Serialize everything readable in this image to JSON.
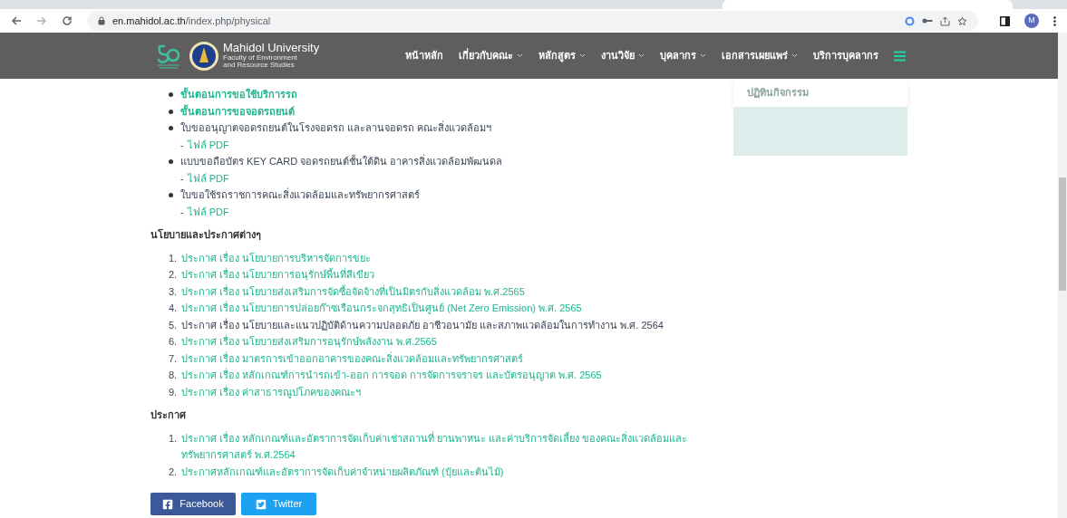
{
  "browser": {
    "url_host": "en.mahidol.ac.th",
    "url_path": "/index.php/physical",
    "profile_initial": "M"
  },
  "navbar": {
    "logo_title": "Mahidol University",
    "logo_line_1": "Faculty of Environment",
    "logo_line_2": "and Resource Studies",
    "items": [
      {
        "label": "หน้าหลัก",
        "dropdown": false
      },
      {
        "label": "เกี่ยวกับคณะ",
        "dropdown": true
      },
      {
        "label": "หลักสูตร",
        "dropdown": true
      },
      {
        "label": "งานวิจัย",
        "dropdown": true
      },
      {
        "label": "บุคลากร",
        "dropdown": true
      },
      {
        "label": "เอกสารเผยแพร่",
        "dropdown": true
      },
      {
        "label": "บริการบุคลากร",
        "dropdown": false
      }
    ]
  },
  "bullets": [
    {
      "text": "ขั้นตอนการขอใช้บริการรถ",
      "link": true
    },
    {
      "text": "ขั้นตอนการขอจอดรถยนต์",
      "link": true
    },
    {
      "text": "ใบขออนุญาตจอดรถยนต์ในโรงจอดรถ และลานจอดรถ คณะสิ่งแวดล้อมฯ",
      "link": false,
      "file": {
        "prefix": "-",
        "label": "ไฟล์ PDF"
      }
    },
    {
      "text": "แบบขอถือบัตร KEY CARD จอดรถยนต์ชั้นใต้ดิน อาคารสิ่งแวดล้อมพัฒนดล",
      "link": false,
      "file": {
        "prefix": "-",
        "label": "ไฟล์ PDF"
      }
    },
    {
      "text": "ใบขอใช้รถราชการคณะสิ่งแวดล้อมและทรัพยากรศาสตร์",
      "link": false,
      "file": {
        "prefix": "-",
        "label": "ไฟล์ PDF"
      }
    }
  ],
  "sections": [
    {
      "heading": "นโยบายและประกาศต่างๆ",
      "items": [
        {
          "number": "1.",
          "text": "ประกาศ เรื่อง นโยบายการบริหารจัดการขยะ",
          "link": true
        },
        {
          "number": "2.",
          "text": "ประกาศ เรื่อง นโยบายการอนุรักษ์พื้นที่สีเขียว",
          "link": true
        },
        {
          "number": "3.",
          "text": "ประกาศ เรื่อง นโยบายส่งเสริมการจัดซื้อจัดจ้างที่เป็นมิตรกับสิ่งแวดล้อม พ.ศ.2565",
          "link": true
        },
        {
          "number": "4.",
          "text": "ประกาศ เรื่อง นโยบายการปล่อยก๊าซเรือนกระจกสุทธิเป็นศูนย์ (Net Zero Emission) พ.ศ. 2565",
          "link": true
        },
        {
          "number": "5.",
          "text": "ประกาศ เรื่อง นโยบายและแนวปฏิบัติด้านความปลอดภัย อาชีวอนามัย และสภาพแวดล้อมในการทำงาน พ.ศ. 2564",
          "link": false
        },
        {
          "number": "6.",
          "text": "ประกาศ เรื่อง นโยบายส่งเสริมการอนุรักษ์พลังงาน พ.ศ.2565",
          "link": true
        },
        {
          "number": "7.",
          "text": "ประกาศ เรื่อง มาตรการเข้าออกอาคารของคณะสิ่งแวดล้อมและทรัพยากรศาสตร์",
          "link": true
        },
        {
          "number": "8.",
          "text": "ประกาศ เรื่อง หลักเกณฑ์การนำรถเข้า-ออก การจอด การจัดการจราจร และบัตรอนุญาต พ.ศ. 2565",
          "link": true
        },
        {
          "number": "9.",
          "text": "ประกาศ เรื่อง ค่าสาธารณูปโภคของคณะฯ",
          "link": true
        }
      ]
    },
    {
      "heading": "ประกาศ",
      "items": [
        {
          "number": "1.",
          "text": "ประกาศ เรื่อง หลักเกณฑ์และอัตราการจัดเก็บค่าเช่าสถานที่ ยานพาหนะ และค่าบริการจัดเลี้ยง ของคณะสิ่งแวดล้อมและทรัพยากรศาสตร์ พ.ศ.2564",
          "link": true
        },
        {
          "number": "2.",
          "text": "ประกาศหลักเกณฑ์และอัตราการจัดเก็บค่าจำหน่ายผลิตภัณฑ์ (ปุ๋ยและต้นไม้)",
          "link": true
        }
      ]
    }
  ],
  "share_buttons": [
    {
      "label": "Facebook",
      "kind": "facebook"
    },
    {
      "label": "Twitter",
      "kind": "twitter"
    }
  ],
  "sidebar": {
    "card_text": "ปฏิทินกิจกรรม"
  }
}
